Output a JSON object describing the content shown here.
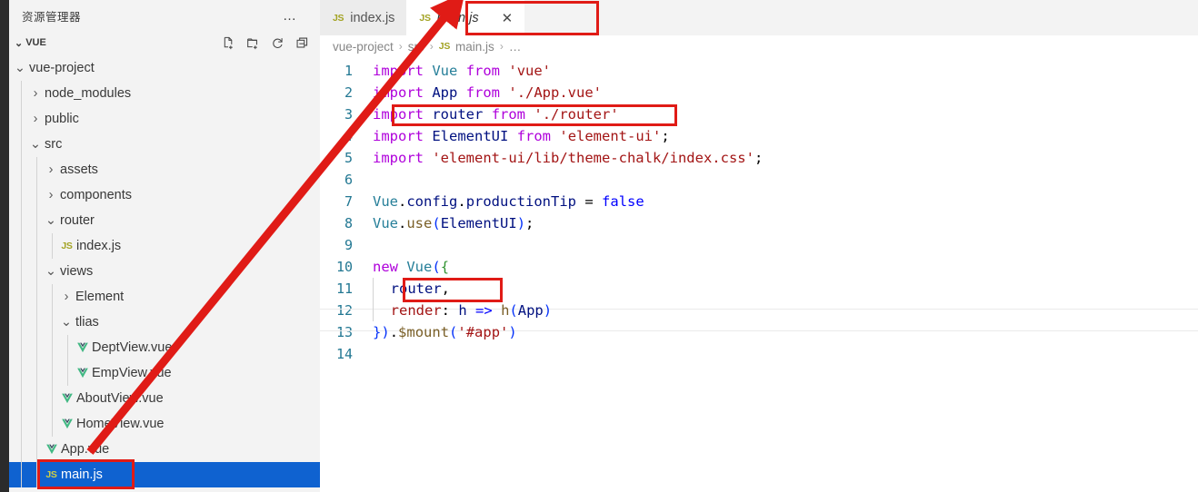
{
  "sidebar": {
    "title": "资源管理器",
    "more_label": "…",
    "section": {
      "chevron": "⌄",
      "label": "VUE",
      "actions": [
        {
          "name": "new-file-icon",
          "tooltip": "新建文件"
        },
        {
          "name": "new-folder-icon",
          "tooltip": "新建文件夹"
        },
        {
          "name": "refresh-icon",
          "tooltip": "刷新资源管理器"
        },
        {
          "name": "collapse-all-icon",
          "tooltip": "在资源管理器中折叠文件夹"
        }
      ]
    },
    "tree": [
      {
        "label": "vue-project",
        "type": "folder",
        "state": "expanded",
        "depth": 1,
        "chevron": "⌄"
      },
      {
        "label": "node_modules",
        "type": "folder",
        "state": "collapsed",
        "depth": 2,
        "chevron": "›"
      },
      {
        "label": "public",
        "type": "folder",
        "state": "collapsed",
        "depth": 2,
        "chevron": "›"
      },
      {
        "label": "src",
        "type": "folder",
        "state": "expanded",
        "depth": 2,
        "chevron": "⌄"
      },
      {
        "label": "assets",
        "type": "folder",
        "state": "collapsed",
        "depth": 3,
        "chevron": "›"
      },
      {
        "label": "components",
        "type": "folder",
        "state": "collapsed",
        "depth": 3,
        "chevron": "›"
      },
      {
        "label": "router",
        "type": "folder",
        "state": "expanded",
        "depth": 3,
        "chevron": "⌄"
      },
      {
        "label": "index.js",
        "type": "js",
        "depth": 4,
        "chevron": ""
      },
      {
        "label": "views",
        "type": "folder",
        "state": "expanded",
        "depth": 3,
        "chevron": "⌄"
      },
      {
        "label": "Element",
        "type": "folder",
        "state": "collapsed",
        "depth": 4,
        "chevron": "›"
      },
      {
        "label": "tlias",
        "type": "folder",
        "state": "expanded",
        "depth": 4,
        "chevron": "⌄"
      },
      {
        "label": "DeptView.vue",
        "type": "vue",
        "depth": 5,
        "chevron": ""
      },
      {
        "label": "EmpView.vue",
        "type": "vue",
        "depth": 5,
        "chevron": ""
      },
      {
        "label": "AboutView.vue",
        "type": "vue",
        "depth": 4,
        "chevron": ""
      },
      {
        "label": "HomeView.vue",
        "type": "vue",
        "depth": 4,
        "chevron": ""
      },
      {
        "label": "App.vue",
        "type": "vue",
        "depth": 3,
        "chevron": ""
      },
      {
        "label": "main.js",
        "type": "js",
        "depth": 3,
        "chevron": "",
        "selected": true
      }
    ]
  },
  "editor": {
    "tabs": [
      {
        "label": "index.js",
        "icon": "js",
        "active": false,
        "closable": false
      },
      {
        "label": "main.js",
        "icon": "js",
        "active": true,
        "closable": true,
        "close_glyph": "✕"
      }
    ],
    "breadcrumb": {
      "items": [
        "vue-project",
        "src",
        "main.js",
        "…"
      ],
      "separator": "›",
      "file_icon_label": "JS"
    },
    "language_badge": "JS",
    "line_numbers": [
      "1",
      "2",
      "3",
      "4",
      "5",
      "6",
      "7",
      "8",
      "9",
      "10",
      "11",
      "12",
      "13",
      "14"
    ],
    "code_lines": [
      "import Vue from 'vue'",
      "import App from './App.vue'",
      "import router from './router'",
      "import ElementUI from 'element-ui';",
      "import 'element-ui/lib/theme-chalk/index.css';",
      "",
      "Vue.config.productionTip = false",
      "Vue.use(ElementUI);",
      "",
      "new Vue({",
      "  router,",
      "  render: h => h(App)",
      "}).$mount('#app')",
      ""
    ]
  },
  "annotations": {
    "color": "#e01b16",
    "boxes": [
      {
        "name": "highlight-tab-mainjs",
        "target": "main.js tab"
      },
      {
        "name": "highlight-import-router",
        "target": "import router from './router'"
      },
      {
        "name": "highlight-router-option",
        "target": "router,"
      },
      {
        "name": "highlight-file-mainjs",
        "target": "main.js file in explorer"
      }
    ],
    "arrow": {
      "name": "pointer-arrow",
      "from": "main.js file in explorer",
      "to": "main.js editor tab"
    }
  },
  "colors": {
    "accent_selection": "#0f62d0",
    "annotation_red": "#e01b16",
    "sidebar_bg": "#f3f3f3",
    "editor_bg": "#ffffff",
    "line_number": "#237893",
    "js_icon": "#a3a324",
    "vue_icon": "#41b883"
  }
}
